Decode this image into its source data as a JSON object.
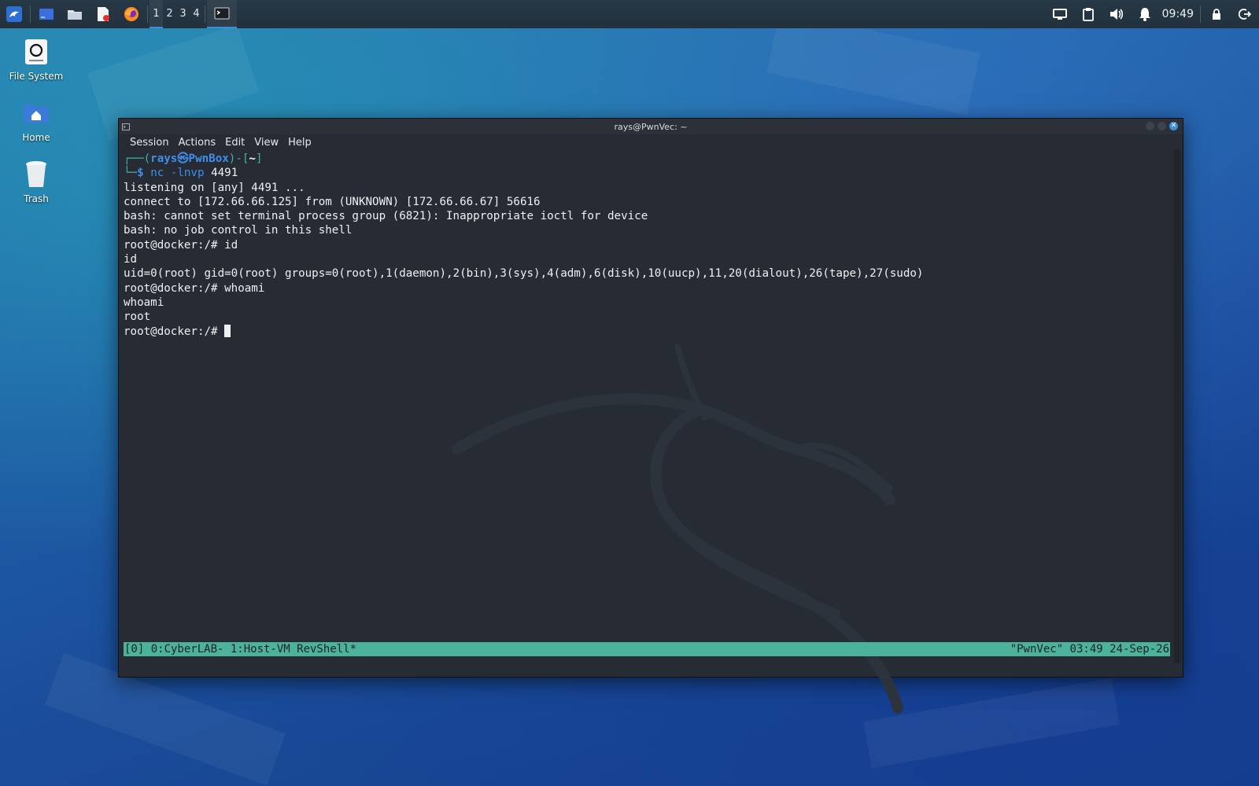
{
  "panel": {
    "workspaces": [
      "1",
      "2",
      "3",
      "4"
    ],
    "clock": "09:49"
  },
  "desktop": {
    "icons": [
      {
        "label": "File System"
      },
      {
        "label": "Home"
      },
      {
        "label": "Trash"
      }
    ]
  },
  "window": {
    "title": "rays@PwnVec: ~",
    "menu": [
      "Session",
      "Actions",
      "Edit",
      "View",
      "Help"
    ]
  },
  "terminal": {
    "prompt_header": {
      "lead": "┌──(",
      "user": "rays",
      "at": "㉿",
      "host": "PwnBox",
      "mid": ")-[",
      "dir": "~",
      "end": "]"
    },
    "prompt_cmd": {
      "lead": "└─",
      "symbol": "$",
      "command": "nc -lnvp",
      "arg": "4491"
    },
    "output": [
      "listening on [any] 4491 ...",
      "connect to [172.66.66.125] from (UNKNOWN) [172.66.66.67] 56616",
      "bash: cannot set terminal process group (6821): Inappropriate ioctl for device",
      "bash: no job control in this shell",
      "root@docker:/# id",
      "id",
      "uid=0(root) gid=0(root) groups=0(root),1(daemon),2(bin),3(sys),4(adm),6(disk),10(uucp),11,20(dialout),26(tape),27(sudo)",
      "root@docker:/# whoami",
      "whoami",
      "root"
    ],
    "current_prompt": "root@docker:/# "
  },
  "tmux": {
    "left": "[0] 0:CyberLAB- 1:Host-VM RevShell*",
    "right": "\"PwnVec\" 03:49 24-Sep-26"
  },
  "colors": {
    "status_bar": "#4bb39b",
    "prompt_green": "#44b3a6",
    "prompt_blue": "#3e8fe8",
    "terminal_bg": "#262b34"
  }
}
